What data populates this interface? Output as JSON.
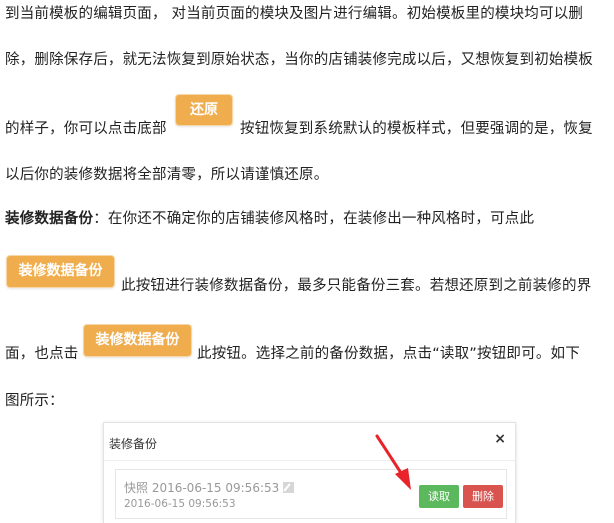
{
  "paragraph1": {
    "line1": "到当前模板的编辑页面， 对当前页面的模块及图片进行编辑。初始模板里的模块均可以删",
    "line2": "除，删除保存后，就无法恢复到原始状态，当你的店铺装修完成以后，又想恢复到初始模板",
    "line3_before": "的样子，你可以点击底部",
    "restore_button": "还原",
    "line3_after": "按钮恢复到系统默认的模板样式，但要强调的是，恢复",
    "line4": "以后你的装修数据将全部清零，所以请谨慎还原。"
  },
  "paragraph2": {
    "bold_label": "装修数据备份",
    "line1_rest": "：在你还不确定你的店铺装修风格时，在装修出一种风格时，可点此",
    "backup_button": "装修数据备份",
    "line2_after": "此按钮进行装修数据备份，最多只能备份三套。若想还原到之前装修的界",
    "line3_before": "面，也点击",
    "backup_button_2": "装修数据备份",
    "line3_after": "此按钮。选择之前的备份数据，点击“读取”按钮即可。如下",
    "line4": "图所示："
  },
  "modal": {
    "title": "装修备份",
    "close_icon": "×",
    "snapshot_name": "快照 2016-06-15 09:56:53",
    "snapshot_date": "2016-06-15 09:56:53",
    "read_label": "读取",
    "delete_label": "删除",
    "read_color": "#5cb85c",
    "delete_color": "#d9534f"
  },
  "colors": {
    "orange_button": "#f0ad4e",
    "arrow": "#e8232a"
  }
}
